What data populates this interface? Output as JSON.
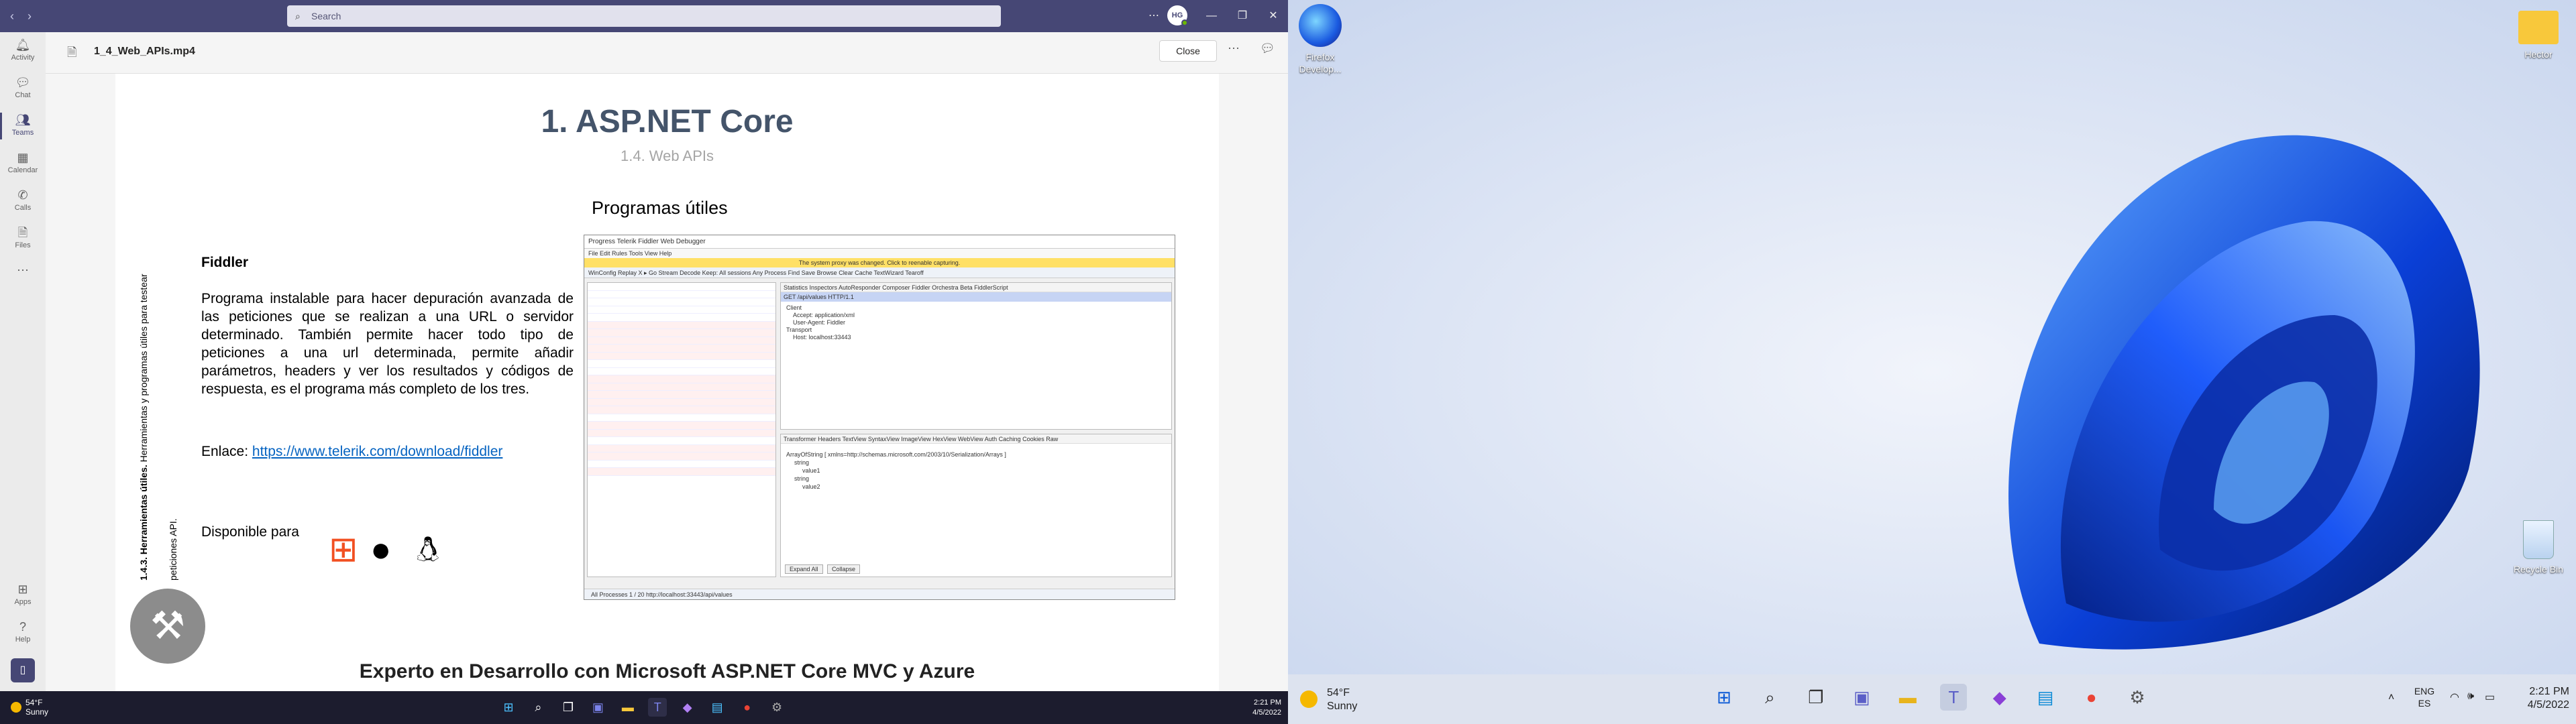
{
  "teams": {
    "search_placeholder": "Search",
    "avatar_initials": "HG",
    "rail": [
      {
        "label": "Activity",
        "icon": "bell-icon"
      },
      {
        "label": "Chat",
        "icon": "chat-icon"
      },
      {
        "label": "Teams",
        "icon": "teams-icon"
      },
      {
        "label": "Calendar",
        "icon": "calendar-icon"
      },
      {
        "label": "Calls",
        "icon": "phone-icon"
      },
      {
        "label": "Files",
        "icon": "file-icon"
      },
      {
        "label": "Apps",
        "icon": "apps-icon"
      },
      {
        "label": "Help",
        "icon": "help-icon"
      }
    ],
    "file_title": "1_4_Web_APIs.mp4",
    "close_label": "Close"
  },
  "slide": {
    "title": "1. ASP.NET Core",
    "subtitle": "1.4. Web APIs",
    "heading": "Programas útiles",
    "vertical_label_bold": "1.4.3. Herramientas útiles.",
    "vertical_label_rest": " Herramientas y programas útiles para testear",
    "vertical_label_line2": "peticiones API.",
    "section": "Fiddler",
    "paragraph": "Programa instalable para hacer depuración avanzada de las peticiones que se realizan a una URL o servidor determinado. También permite hacer todo tipo de peticiones a una url determinada, permite añadir parámetros, headers y ver los resultados y códigos de respuesta, es el programa más completo de los tres.",
    "link_prefix": "Enlace: ",
    "link": "https://www.telerik.com/download/fiddler",
    "available": "Disponible para",
    "footer": "Experto en Desarrollo con Microsoft ASP.NET Core MVC y Azure",
    "fiddler": {
      "title": "Progress Telerik Fiddler Web Debugger",
      "menu": "File  Edit  Rules  Tools  View  Help",
      "warning": "The system proxy was changed. Click to reenable capturing.",
      "toolbar": "WinConfig   Replay   X ▸ Go   Stream   Decode   Keep: All sessions   Any Process   Find   Save   Browse   Clear Cache   TextWizard   Tearoff",
      "tabs": "Statistics   Inspectors   AutoResponder   Composer   Fiddler Orchestra Beta   FiddlerScript",
      "req_header": "GET /api/values HTTP/1.1",
      "req_lines": [
        "Client",
        "Accept: application/xml",
        "User-Agent: Fiddler",
        "Transport",
        "Host: localhost:33443"
      ],
      "resp_tabs": "Transformer   Headers   TextView   SyntaxView   ImageView   HexView   WebView   Auth   Caching   Cookies   Raw",
      "resp_lines": [
        "ArrayOfString [ xmlns=http://schemas.microsoft.com/2003/10/Serialization/Arrays ]",
        "string",
        "value1",
        "string",
        "value2"
      ],
      "expand": "Expand All",
      "collapse": "Collapse",
      "status": "All Processes     1 / 20     http://localhost:33443/api/values"
    }
  },
  "left_taskbar": {
    "weather_temp": "54°F",
    "weather_desc": "Sunny",
    "time": "2:21 PM",
    "date": "4/5/2022"
  },
  "desktop": {
    "icons": [
      {
        "label": "Firefox Develop...",
        "icon": "firefox-icon"
      },
      {
        "label": "Hector",
        "icon": "folder-icon"
      },
      {
        "label": "Recycle Bin",
        "icon": "recycle-bin-icon"
      }
    ],
    "weather_temp": "54°F",
    "weather_desc": "Sunny",
    "lang1": "ENG",
    "lang2": "ES",
    "time": "2:21 PM",
    "date": "4/5/2022",
    "accent": "#0a3fd6"
  }
}
